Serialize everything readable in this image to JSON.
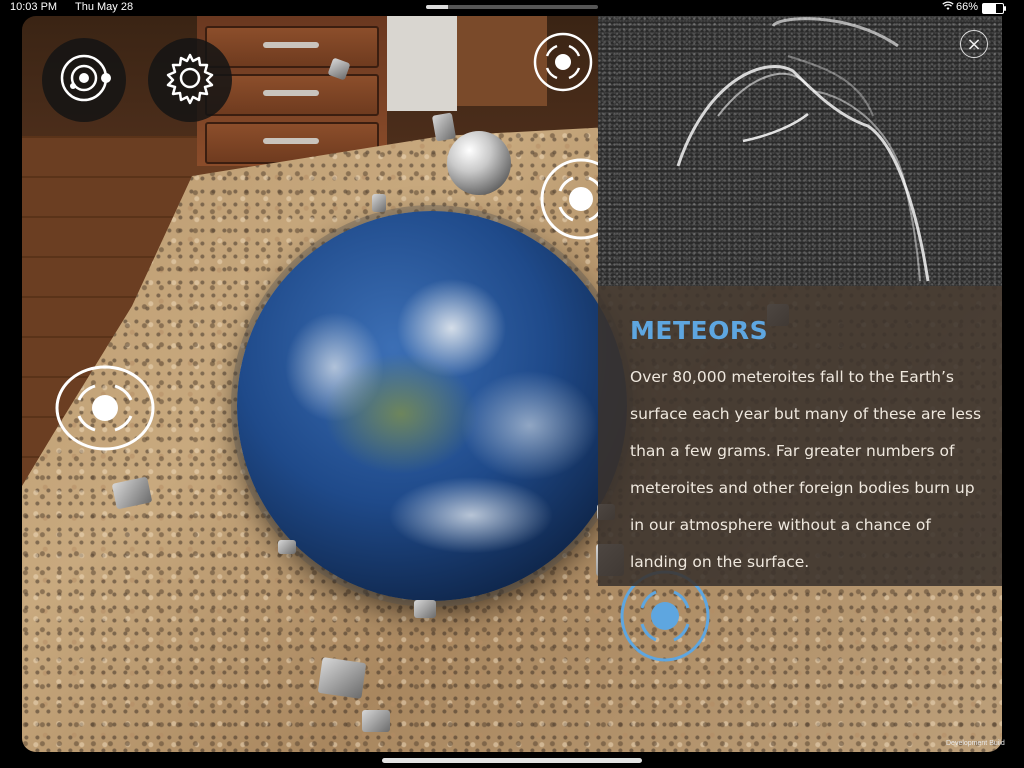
{
  "status_bar": {
    "time": "10:03 PM",
    "date": "Thu May 28",
    "battery_percent": "66%",
    "battery_level": 0.66,
    "wifi_icon": "wifi-icon"
  },
  "info_panel": {
    "title": "METEORS",
    "body": "Over 80,000 meteroites fall to the Earth’s surface each year but many of these are less than a few grams. Far greater numbers of meteroites and other foreign bodies burn up in our atmosphere without a chance of landing on the surface.",
    "close_icon": "close-icon",
    "close_glyph": "×"
  },
  "toolbar": {
    "solar_system_icon": "solar-system-icon",
    "settings_icon": "gear-icon"
  },
  "hotspots": [
    "orbit-hotspot-icon",
    "orbit-hotspot-icon",
    "orbit-hotspot-icon",
    "orbit-hotspot-icon"
  ],
  "footer": {
    "dev_build": "Development Build"
  },
  "colors": {
    "accent": "#5ea6e0",
    "hotspot_white": "#ffffff",
    "panel_bg": "#3a322c"
  }
}
